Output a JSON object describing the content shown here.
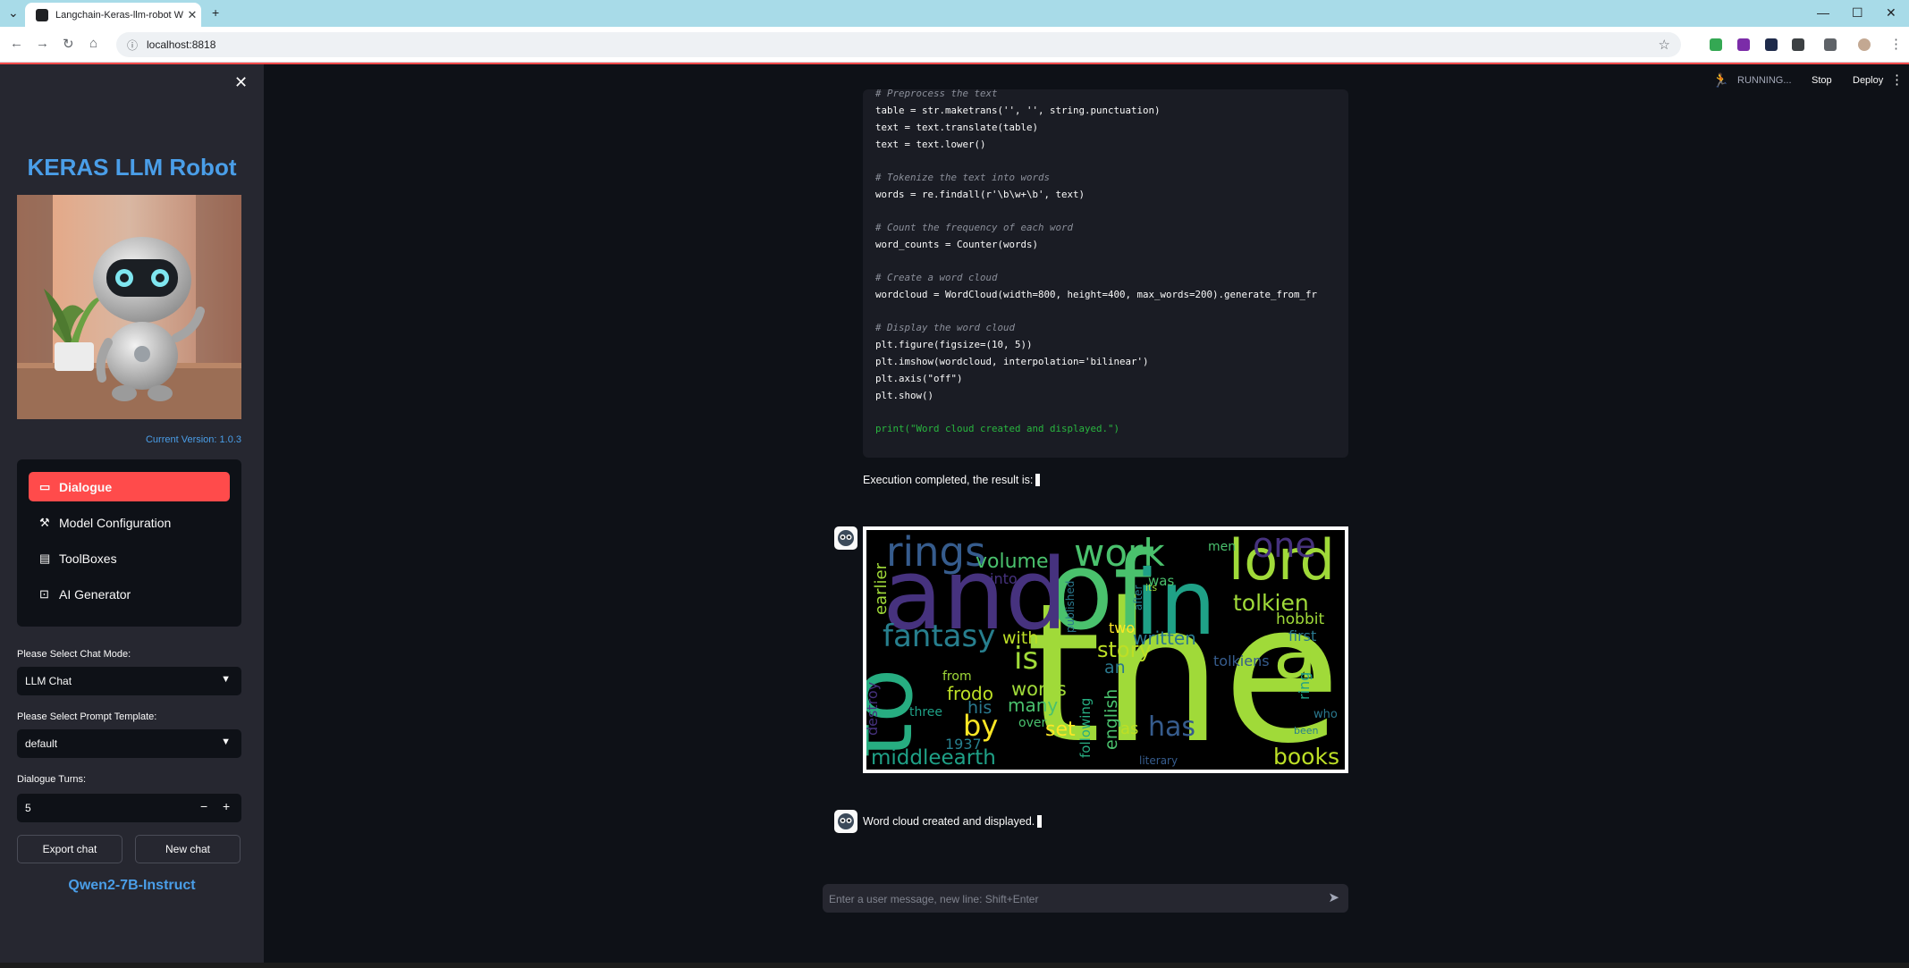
{
  "browser": {
    "tab_title": "Langchain-Keras-llm-robot We",
    "tab_close": "✕",
    "new_tab": "+",
    "url": "localhost:8818",
    "window_controls": [
      "—",
      "☐",
      "✕"
    ]
  },
  "sidebar": {
    "close": "✕",
    "title": "KERAS LLM Robot",
    "version": "Current Version: 1.0.3",
    "nav": [
      {
        "label": "Dialogue",
        "icon": "chat-icon",
        "active": true
      },
      {
        "label": "Model Configuration",
        "icon": "wrench-icon",
        "active": false
      },
      {
        "label": "ToolBoxes",
        "icon": "toolbox-icon",
        "active": false
      },
      {
        "label": "AI Generator",
        "icon": "robot-icon",
        "active": false
      }
    ],
    "chat_mode_label": "Please Select Chat Mode:",
    "chat_mode_value": "LLM Chat",
    "prompt_label": "Please Select Prompt Template:",
    "prompt_value": "default",
    "turns_label": "Dialogue Turns:",
    "turns_value": "5",
    "turns_minus": "−",
    "turns_plus": "+",
    "export_label": "Export chat",
    "new_chat_label": "New chat",
    "model_name": "Qwen2-7B-Instruct"
  },
  "header": {
    "status": "RUNNING...",
    "stop": "Stop",
    "deploy": "Deploy"
  },
  "chat": {
    "code_lines": [
      "# Preprocess the text",
      "table = str.maketrans('', '', string.punctuation)",
      "text = text.translate(table)",
      "text = text.lower()",
      "",
      "# Tokenize the text into words",
      "words = re.findall(r'\\b\\w+\\b', text)",
      "",
      "# Count the frequency of each word",
      "word_counts = Counter(words)",
      "",
      "# Create a word cloud",
      "wordcloud = WordCloud(width=800, height=400, max_words=200).generate_from_fr",
      "",
      "# Display the word cloud",
      "plt.figure(figsize=(10, 5))",
      "plt.imshow(wordcloud, interpolation='bilinear')",
      "plt.axis(\"off\")",
      "plt.show()",
      "",
      "print(\"Word cloud created and displayed.\")"
    ],
    "exec_text": "Execution completed, the result is:",
    "result_text": "Word cloud created and displayed.",
    "input_placeholder": "Enter a user message, new line: Shift+Enter"
  },
  "wordcloud": {
    "words": [
      {
        "t": "the",
        "c": "#a0da39"
      },
      {
        "t": "of",
        "c": "#4ac16d"
      },
      {
        "t": "and",
        "c": "#46327e"
      },
      {
        "t": "in",
        "c": "#1fa187"
      },
      {
        "t": "to",
        "c": "#27ad81"
      },
      {
        "t": "a",
        "c": "#a0da39"
      },
      {
        "t": "lord",
        "c": "#a0da39"
      },
      {
        "t": "rings",
        "c": "#365c8d"
      },
      {
        "t": "work",
        "c": "#4ac16d"
      },
      {
        "t": "one",
        "c": "#46327e"
      },
      {
        "t": "fantasy",
        "c": "#277f8e"
      },
      {
        "t": "is",
        "c": "#a0da39"
      },
      {
        "t": "by",
        "c": "#fde725"
      },
      {
        "t": "has",
        "c": "#365c8d"
      },
      {
        "t": "tolkien",
        "c": "#a0da39"
      },
      {
        "t": "middleearth",
        "c": "#1fa187"
      },
      {
        "t": "books",
        "c": "#bddf26"
      },
      {
        "t": "story",
        "c": "#bddf26"
      },
      {
        "t": "frodo",
        "c": "#bddf26"
      },
      {
        "t": "works",
        "c": "#a0da39"
      },
      {
        "t": "many",
        "c": "#4ac16d"
      },
      {
        "t": "written",
        "c": "#2a788e"
      },
      {
        "t": "volume",
        "c": "#4ac16d"
      },
      {
        "t": "earlier",
        "c": "#a0da39"
      },
      {
        "t": "with",
        "c": "#bddf26"
      },
      {
        "t": "english",
        "c": "#4ac16d"
      },
      {
        "t": "hobbit",
        "c": "#a0da39"
      },
      {
        "t": "his",
        "c": "#2a788e"
      },
      {
        "t": "set",
        "c": "#fde725"
      },
      {
        "t": "as",
        "c": "#bddf26"
      },
      {
        "t": "1937",
        "c": "#277f8e"
      },
      {
        "t": "tolkiens",
        "c": "#365c8d"
      },
      {
        "t": "destroy",
        "c": "#46327e"
      },
      {
        "t": "first",
        "c": "#2a788e"
      },
      {
        "t": "ring",
        "c": "#1fa187"
      },
      {
        "t": "men",
        "c": "#4ac16d"
      },
      {
        "t": "an",
        "c": "#2a788e"
      },
      {
        "t": "was",
        "c": "#4ac16d"
      },
      {
        "t": "into",
        "c": "#46327e"
      },
      {
        "t": "from",
        "c": "#a0da39"
      },
      {
        "t": "over",
        "c": "#4ac16d"
      },
      {
        "t": "following",
        "c": "#27ad81"
      },
      {
        "t": "three",
        "c": "#1fa187"
      },
      {
        "t": "published",
        "c": "#2a788e"
      },
      {
        "t": "two",
        "c": "#fde725"
      },
      {
        "t": "literary",
        "c": "#365c8d"
      },
      {
        "t": "been",
        "c": "#277f8e"
      },
      {
        "t": "who",
        "c": "#2a788e"
      },
      {
        "t": "after",
        "c": "#277f8e"
      },
      {
        "t": "its",
        "c": "#a0da39"
      }
    ]
  }
}
